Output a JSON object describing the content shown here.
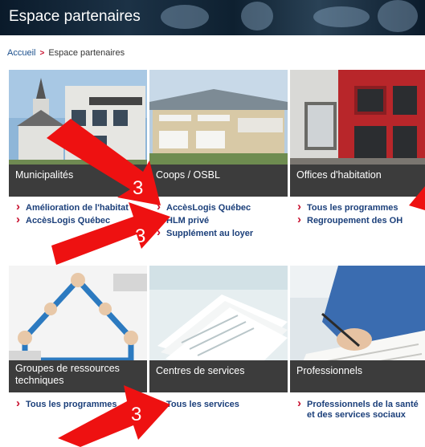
{
  "banner": {
    "title": "Espace partenaires"
  },
  "breadcrumb": {
    "home": "Accueil",
    "current": "Espace partenaires"
  },
  "tiles": [
    {
      "caption": "Municipalités",
      "links": [
        "Amélioration de l'habitat",
        "AccèsLogis Québec"
      ]
    },
    {
      "caption": "Coops / OSBL",
      "links": [
        "AccèsLogis Québec",
        "HLM privé",
        "Supplément au loyer"
      ]
    },
    {
      "caption": "Offices d'habitation",
      "links": [
        "Tous les programmes",
        "Regroupement des OH"
      ]
    },
    {
      "caption": "Groupes de ressources techniques",
      "links": [
        "Tous les programmes"
      ]
    },
    {
      "caption": "Centres de services",
      "links": [
        "Tous les services"
      ]
    },
    {
      "caption": "Professionnels",
      "links": [
        "Professionnels de la santé et des services sociaux"
      ]
    }
  ],
  "annotations": {
    "marker_label": "3",
    "arrow_color": "#ee1111"
  }
}
